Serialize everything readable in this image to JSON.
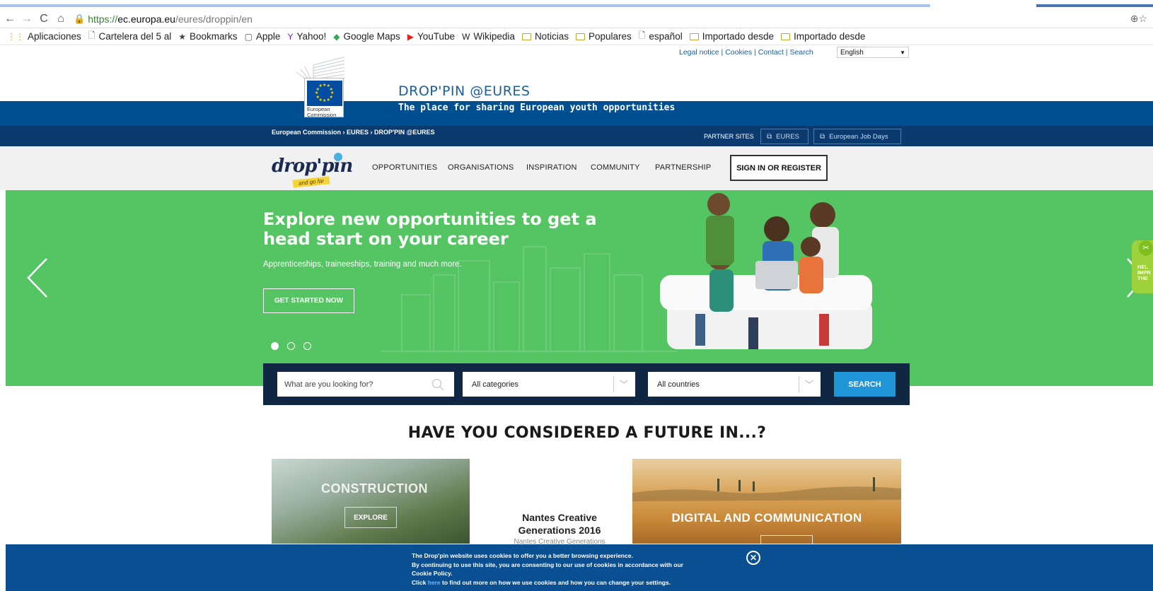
{
  "browser": {
    "url_https": "https://",
    "url_host": "ec.europa.eu",
    "url_path": "/eures/droppin/en",
    "bookmarks": [
      {
        "label": "Aplicaciones",
        "icon": "apps-grid-icon"
      },
      {
        "label": "Cartelera del 5 al",
        "icon": "page-icon"
      },
      {
        "label": "Bookmarks",
        "icon": "star-icon"
      },
      {
        "label": "Apple",
        "icon": "apple-icon"
      },
      {
        "label": "Yahoo!",
        "icon": "yahoo-icon"
      },
      {
        "label": "Google Maps",
        "icon": "maps-icon"
      },
      {
        "label": "YouTube",
        "icon": "youtube-icon"
      },
      {
        "label": "Wikipedia",
        "icon": "wikipedia-icon"
      },
      {
        "label": "Noticias",
        "icon": "folder-icon"
      },
      {
        "label": "Populares",
        "icon": "folder-icon"
      },
      {
        "label": "español",
        "icon": "page-icon"
      },
      {
        "label": "Importado desde",
        "icon": "folder-icon"
      },
      {
        "label": "Importado desde",
        "icon": "folder-icon"
      }
    ]
  },
  "header": {
    "toplinks": [
      "Legal notice",
      "Cookies",
      "Contact",
      "Search"
    ],
    "language": "English",
    "ec_caption_line1": "European",
    "ec_caption_line2": "Commission",
    "site_title": "DROP'PIN @EURES",
    "tagline": "The place for sharing European youth opportunities",
    "breadcrumb": "European Commission › EURES › DROP'PIN @EURES",
    "partner_label": "PARTNER SITES",
    "partner_links": [
      "EURES",
      "European Job Days"
    ]
  },
  "nav": {
    "logo_word": "drop'pin",
    "logo_tag": "and go far",
    "items": [
      "OPPORTUNITIES",
      "ORGANISATIONS",
      "INSPIRATION",
      "COMMUNITY",
      "PARTNERSHIP"
    ],
    "signin": "SIGN IN OR REGISTER"
  },
  "hero": {
    "title": "Explore new opportunities to get a head start on your career",
    "subtitle": "Apprenticeships, traineeships, training and much more.",
    "cta": "GET STARTED NOW",
    "slides": 3,
    "active_slide": 1,
    "feedback_text": [
      "HEL",
      "IMPR",
      "THE"
    ]
  },
  "search": {
    "placeholder": "What are you looking for?",
    "category": "All categories",
    "country": "All countries",
    "button": "SEARCH"
  },
  "section": {
    "title": "HAVE YOU CONSIDERED A FUTURE IN...?",
    "tiles": [
      {
        "label": "CONSTRUCTION",
        "button": "EXPLORE"
      },
      {
        "title_line1": "Nantes Creative",
        "title_line2": "Generations 2016",
        "subtitle": "Nantes Creative Generations"
      },
      {
        "label": "DIGITAL AND COMMUNICATION"
      }
    ]
  },
  "cookie": {
    "line1": "The Drop'pin website uses cookies to offer you a better browsing experience.",
    "line2": "By continuing to use this site, you are consenting to our use of cookies in accordance with our",
    "line3": "Cookie Policy.",
    "line4_pre": "Click ",
    "line4_link": "here",
    "line4_post": " to find out more on how we use cookies and how you can change your settings."
  },
  "colors": {
    "hero_green": "#55c463",
    "header_blue": "#004f91",
    "breadcrumb_navy": "#0b3a6e",
    "search_navy": "#0f2742",
    "search_button": "#2095d8",
    "cookie_blue": "#0a4f91"
  }
}
